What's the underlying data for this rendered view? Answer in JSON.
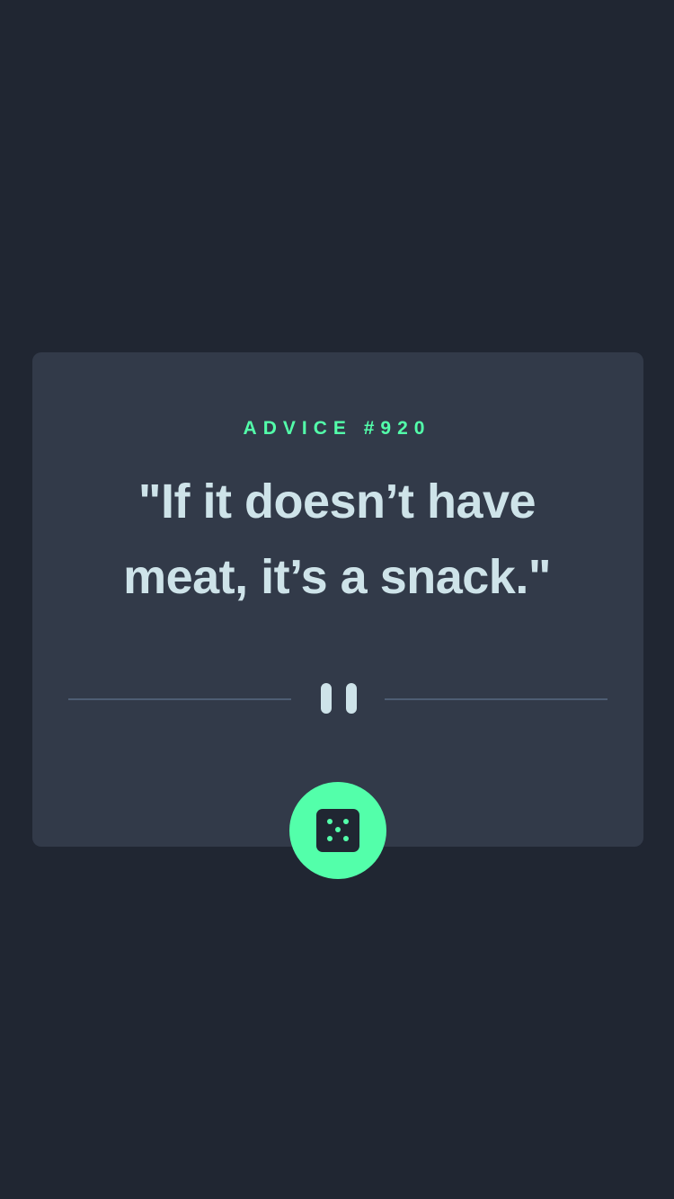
{
  "advice": {
    "id_label": "ADVICE #920",
    "quote": "\"If it doesn’t have meat, it’s a snack.\""
  },
  "icons": {
    "divider": "pause-icon",
    "button": "dice-icon"
  },
  "colors": {
    "background": "#202632",
    "card": "#323a49",
    "accent": "#53ffaa",
    "text": "#cee3e9",
    "divider": "#4e5d73"
  }
}
